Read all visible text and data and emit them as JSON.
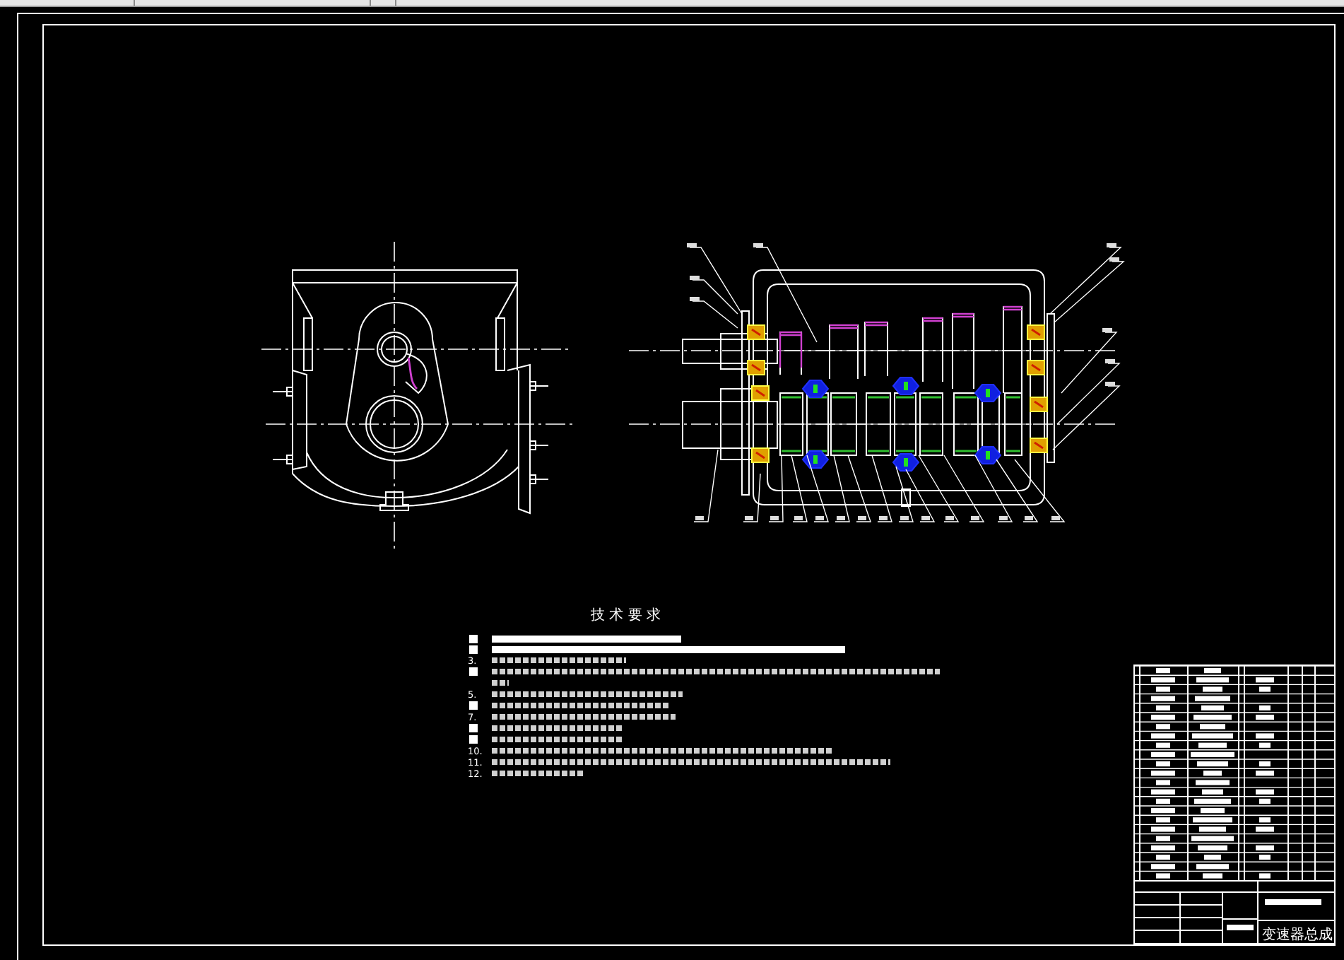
{
  "requirements": {
    "title": "技 术 要 求",
    "items": [
      {
        "kind": "bar"
      },
      {
        "kind": "bar"
      },
      {
        "number": "3.",
        "kind": "line"
      },
      {
        "kind": "wrapped"
      },
      {
        "number": "5.",
        "kind": "line"
      },
      {
        "kind": "line"
      },
      {
        "number": "7.",
        "kind": "line"
      },
      {
        "kind": "line"
      },
      {
        "kind": "line"
      },
      {
        "number": "10.",
        "kind": "line"
      },
      {
        "number": "11.",
        "kind": "line"
      },
      {
        "number": "12.",
        "kind": "line"
      }
    ]
  },
  "title_block": {
    "drawing_name": "变速器总成"
  }
}
